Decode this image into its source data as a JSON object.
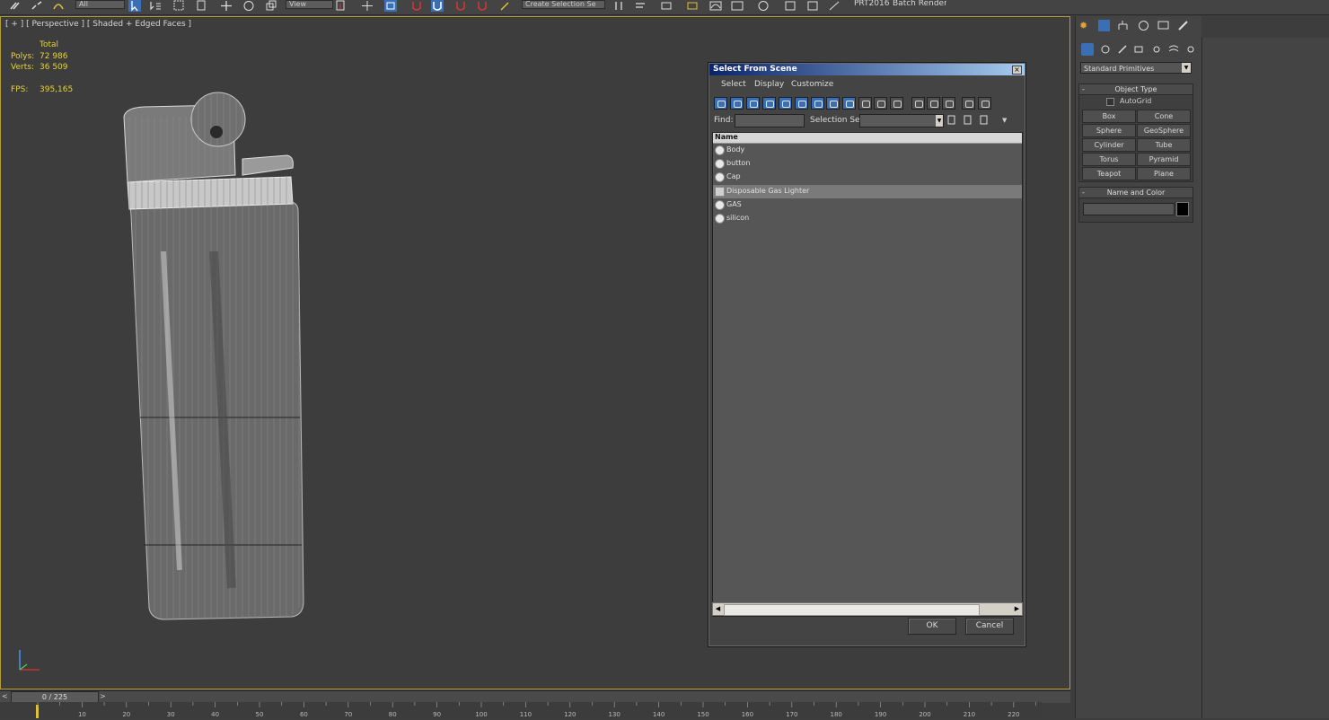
{
  "toolbar": {
    "dropdown_all": "All",
    "dropdown_view": "View",
    "selection_set_placeholder": "Create Selection Se",
    "prt_label": "PRT2016",
    "batch_render_label": "Batch Render..."
  },
  "viewport": {
    "label": "[ + ] [ Perspective ] [ Shaded + Edged Faces ]",
    "stats": {
      "total_label": "Total",
      "polys_label": "Polys:",
      "polys_value": "72 986",
      "verts_label": "Verts:",
      "verts_value": "36 509",
      "fps_label": "FPS:",
      "fps_value": "395,165"
    }
  },
  "dialog": {
    "title": "Select From Scene",
    "close_glyph": "×",
    "menu": [
      "Select",
      "Display",
      "Customize"
    ],
    "find_label": "Find:",
    "find_value": "",
    "selection_set_label": "Selection Set:",
    "selection_set_value": "",
    "column_header": "Name",
    "items": [
      {
        "name": "Body",
        "type": "object",
        "selected": false
      },
      {
        "name": "button",
        "type": "object",
        "selected": false
      },
      {
        "name": "Cap",
        "type": "object",
        "selected": false
      },
      {
        "name": "Disposable Gas Lighter",
        "type": "group",
        "selected": true
      },
      {
        "name": "GAS",
        "type": "object",
        "selected": false
      },
      {
        "name": "silicon",
        "type": "object",
        "selected": false
      }
    ],
    "ok_label": "OK",
    "cancel_label": "Cancel"
  },
  "command_panel": {
    "category_dropdown": "Standard Primitives",
    "object_type_title": "Object Type",
    "autogrid_label": "AutoGrid",
    "primitives": [
      "Box",
      "Cone",
      "Sphere",
      "GeoSphere",
      "Cylinder",
      "Tube",
      "Torus",
      "Pyramid",
      "Teapot",
      "Plane"
    ],
    "name_color_title": "Name and Color",
    "name_value": "",
    "color": "#000000"
  },
  "timeline": {
    "frame_display": "0 / 225",
    "ticks": [
      "10",
      "20",
      "30",
      "40",
      "50",
      "60",
      "70",
      "80",
      "90",
      "100",
      "110",
      "120",
      "130",
      "140",
      "150",
      "160",
      "170",
      "180",
      "190",
      "200",
      "210",
      "220"
    ]
  },
  "colors": {
    "viewport_border": "#b89a3a",
    "stats_text": "#e8d23c",
    "title_bar_start": "#0a246a",
    "title_bar_end": "#a6caf0",
    "toolbar_active": "#3a6fb5"
  }
}
